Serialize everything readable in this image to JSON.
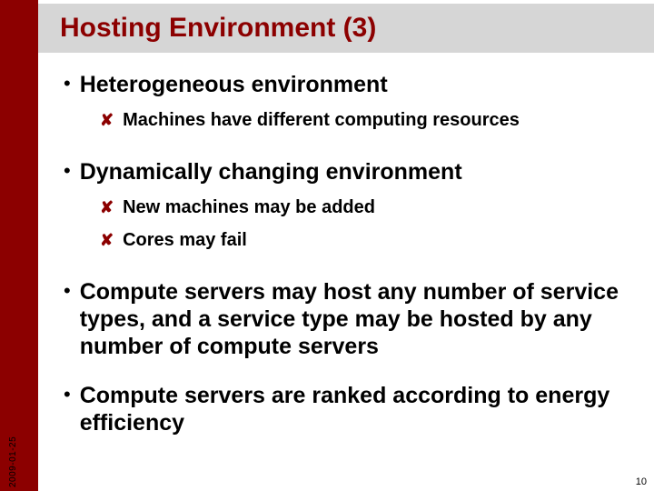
{
  "meta": {
    "date": "2009-01-25",
    "page_number": "10"
  },
  "title": "Hosting Environment (3)",
  "bullets": {
    "b0": {
      "text": "Heterogeneous environment",
      "subs": {
        "s0": "Machines have different computing resources"
      }
    },
    "b1": {
      "text": "Dynamically changing environment",
      "subs": {
        "s0": "New machines may be added",
        "s1": "Cores may fail"
      }
    },
    "b2": {
      "text": "Compute servers may host any number of service types, and a service type may be hosted by any number of compute servers"
    },
    "b3": {
      "text": "Compute servers are ranked according to energy efficiency"
    }
  }
}
